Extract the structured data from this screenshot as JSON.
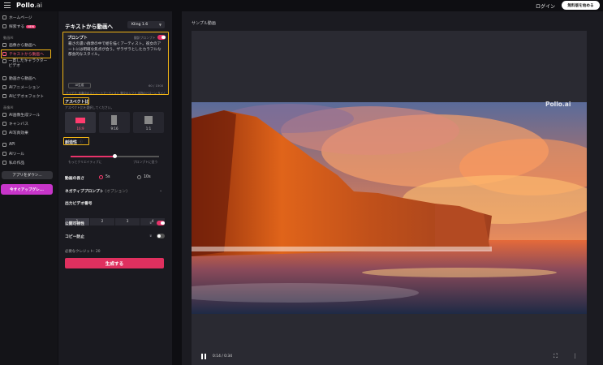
{
  "topbar": {
    "logo_main": "Pollo",
    "logo_suffix": ".ai",
    "login": "ログイン",
    "start_free": "無料版を始める"
  },
  "sidebar": {
    "items": [
      {
        "label": "ホームページ"
      },
      {
        "label": "探索する",
        "badge": "NEW"
      },
      {
        "section": "動画AI"
      },
      {
        "label": "画像から動画へ"
      },
      {
        "label": "テキストから動画へ"
      },
      {
        "label": "一貫したキャラクタービデオ"
      },
      {
        "label": "動画から動画へ"
      },
      {
        "label": "AIアニメーション"
      },
      {
        "label": "AIビデオエフェクト"
      },
      {
        "section": "画像AI"
      },
      {
        "label": "AI画像生成ツール"
      },
      {
        "label": "キャンバス"
      },
      {
        "label": "AI写真効果"
      },
      {
        "label": "API"
      },
      {
        "label": "AIツール"
      },
      {
        "label": "私の作品"
      }
    ],
    "app_download": "アプリをダウン...",
    "upgrade": "今すぐアップグレ..."
  },
  "panel": {
    "title": "テキストから動画へ",
    "model": "Kling 1.6",
    "prompt_label": "プロンプト",
    "translate_label": "翻訳プロンプト",
    "prompt_text": "霧さの濃い群衆の中で絵を描くアーティスト。彼女のアートには明確な焦点が合う。ザラザラとしたカラフルな都会的なスタイル。",
    "ai_btn": "AI生成",
    "char_count": "60 / 1500",
    "ideas": "アイデア: 伴奏中のストリートアーティスト 雪空のシフト 本物のドローン タイムラプス フレーム",
    "aspect_label": "アスペクト比",
    "aspect_hint": "アスペクト比を選択してください。",
    "ratios": [
      "16:9",
      "9:16",
      "1:1"
    ],
    "motion_label": "創造性",
    "slider_value": 0.5,
    "slider_left": "もっとクリエイティブに",
    "slider_right": "プロンプトに従う",
    "length_label": "動画の長さ",
    "length_options": [
      "5s",
      "10s"
    ],
    "negative_label": "ネガティブプロンプト",
    "negative_opt": "(オプション)",
    "output_label": "出力ビデオ番号",
    "outputs": [
      "1",
      "2",
      "3",
      "4"
    ],
    "public_label": "公開可視性",
    "copy_label": "コピー防止",
    "credits": "必要なクレジット: 20",
    "generate": "生成する"
  },
  "right": {
    "sample": "サンプル動画",
    "watermark": "Pollo.ai",
    "time": "0:14 / 0:34"
  },
  "colors": {
    "accent": "#e8336a",
    "highlight": "#f2b515"
  }
}
